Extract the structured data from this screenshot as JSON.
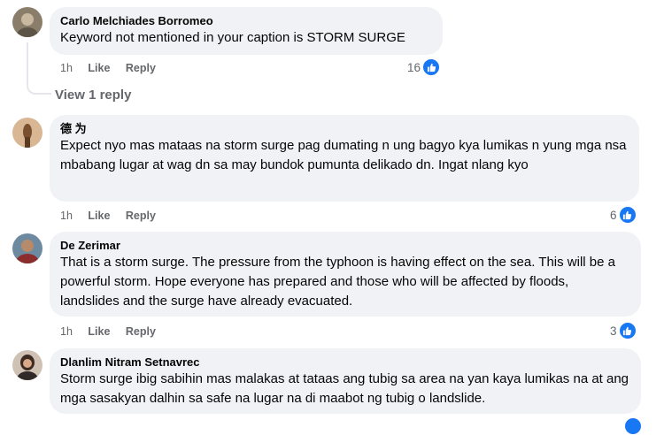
{
  "comments": [
    {
      "author": "Carlo Melchiades Borromeo",
      "text": "Keyword not mentioned in your caption is STORM SURGE",
      "time": "1h",
      "like": "Like",
      "reply": "Reply",
      "reactions": "16"
    },
    {
      "author": "德 为",
      "text": "Expect nyo mas mataas na storm surge pag dumating n ung bagyo kya lumikas n yung mga nsa mbabang lugar at wag dn sa may bundok pumunta delikado dn. Ingat nlang kyo",
      "time": "1h",
      "like": "Like",
      "reply": "Reply",
      "reactions": "6"
    },
    {
      "author": "De Zerimar",
      "text": "That is a storm surge. The pressure from the typhoon is having effect on the sea. This will be a powerful storm. Hope everyone has prepared and those who will be affected by floods, landslides and the surge have already evacuated.",
      "time": "1h",
      "like": "Like",
      "reply": "Reply",
      "reactions": "3"
    },
    {
      "author": "Dlanlim Nitram Setnavrec",
      "text": "Storm surge ibig sabihin mas malakas at tataas ang tubig sa area na yan kaya lumikas na at ang mga sasakyan dalhin sa safe na lugar na di maabot ng tubig o landslide.",
      "time": "",
      "like": "",
      "reply": "",
      "reactions": ""
    }
  ],
  "view_replies": "View 1 reply",
  "colors": {
    "bubble": "#f0f2f5",
    "like_blue": "#1877f2",
    "meta_gray": "#65676b"
  },
  "icons": {
    "reaction": "like-thumb-icon",
    "avatar": "profile-avatar"
  }
}
